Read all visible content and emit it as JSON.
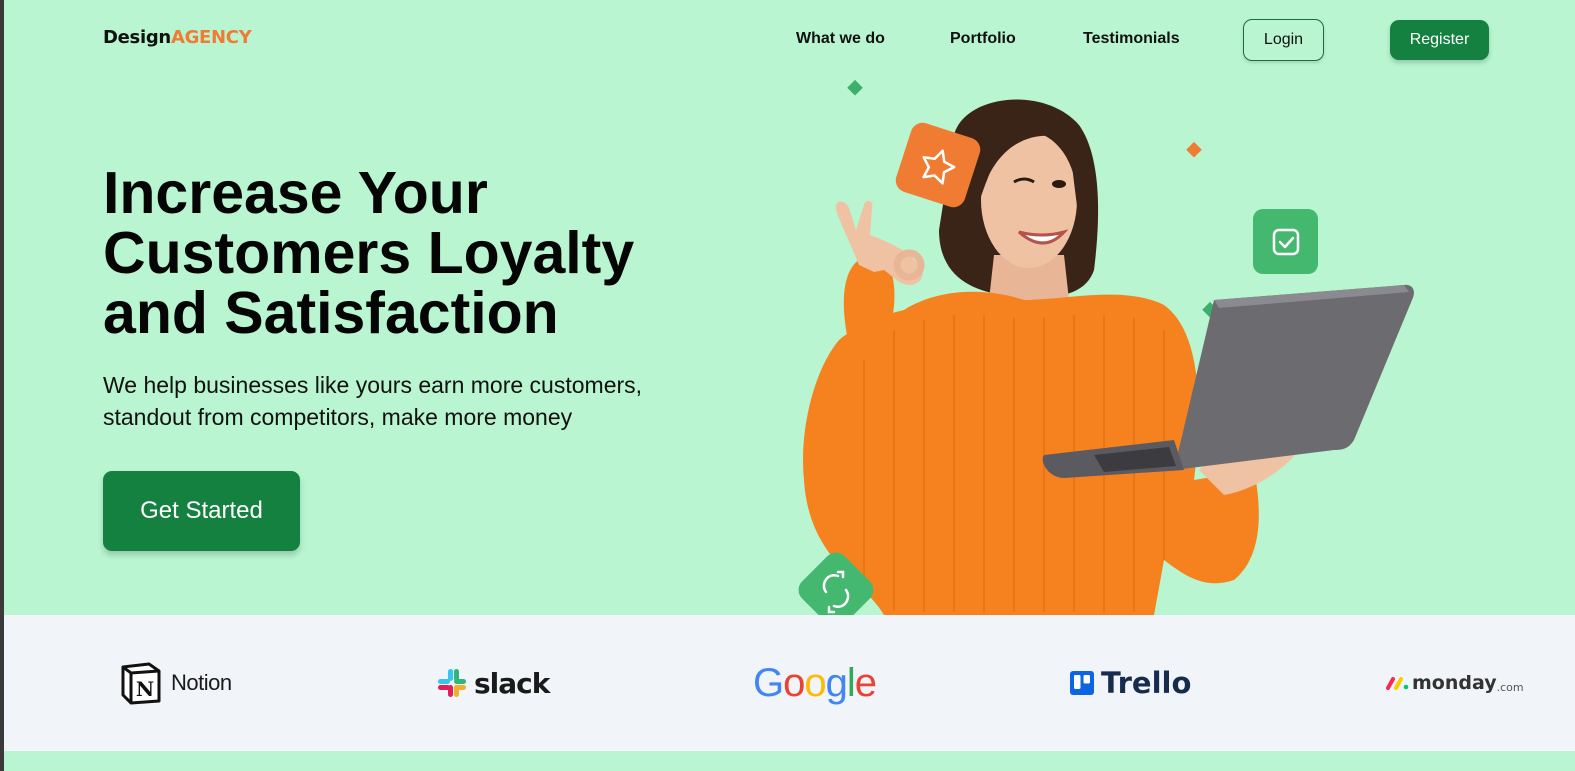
{
  "header": {
    "logo_part1": "Design",
    "logo_part2": "AGENCY",
    "nav": [
      "What we do",
      "Portfolio",
      "Testimonials"
    ],
    "login_label": "Login",
    "register_label": "Register"
  },
  "hero": {
    "title_lines": [
      "Increase Your",
      "Customers Loyalty",
      "and Satisfaction"
    ],
    "subtitle_lines": [
      "We help businesses like yours earn more customers,",
      "standout from competitors, make more money"
    ],
    "cta_label": "Get Started"
  },
  "partners": {
    "notion": "Notion",
    "slack": "slack",
    "google": [
      "G",
      "o",
      "o",
      "g",
      "l",
      "e"
    ],
    "trello": "Trello",
    "monday": "monday",
    "monday_suffix": ".com"
  },
  "colors": {
    "background": "#b8f5d0",
    "primary_green": "#158140",
    "accent_orange": "#f07c34",
    "logo_strip": "#f1f4f8"
  },
  "icons": [
    "star-icon",
    "check-square-icon",
    "sync-icon"
  ]
}
